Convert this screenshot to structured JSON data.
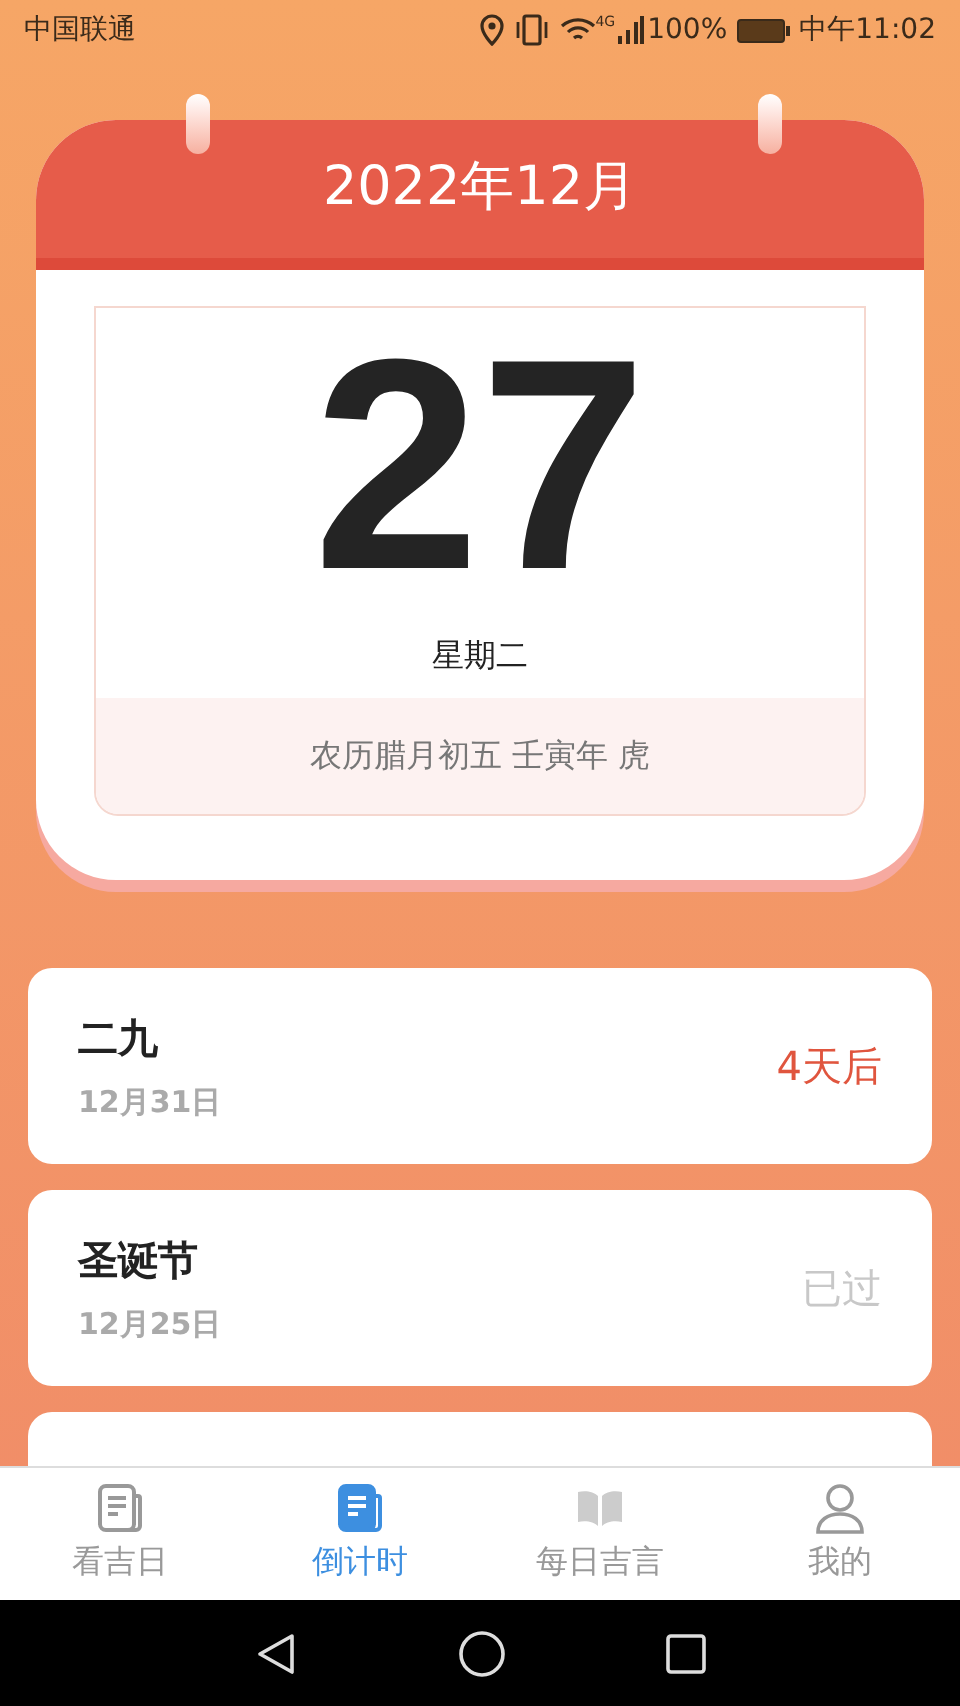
{
  "status_bar": {
    "carrier": "中国联通",
    "network": "4G",
    "battery": "100%",
    "time": "中午11:02"
  },
  "calendar": {
    "month": "2022年12月",
    "day": "27",
    "weekday": "星期二",
    "lunar": "农历腊月初五 壬寅年 虎"
  },
  "events": [
    {
      "title": "二九",
      "date": "12月31日",
      "countdown": "4天后",
      "kind": "upcoming"
    },
    {
      "title": "圣诞节",
      "date": "12月25日",
      "countdown": "已过",
      "kind": "past"
    },
    {
      "kind": "partial"
    }
  ],
  "tabs": [
    {
      "label": "看吉日",
      "selected": false
    },
    {
      "label": "倒计时",
      "selected": true
    },
    {
      "label": "每日吉言",
      "selected": false
    },
    {
      "label": "我的",
      "selected": false
    }
  ]
}
